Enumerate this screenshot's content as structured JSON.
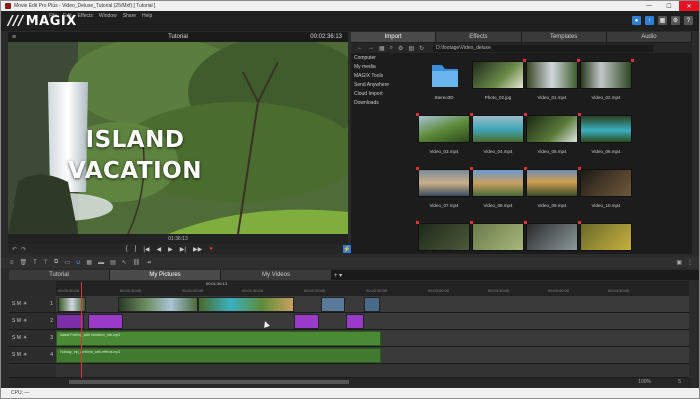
{
  "window": {
    "title": "Movie Edit Pro Plus - Video_Deluxe_Tutorial (25/Mxf) [ Tutorial ]",
    "controls": [
      "—",
      "☐",
      "✕"
    ]
  },
  "menubar": {
    "logo": "MAGIX",
    "items": [
      "File",
      "Edit",
      "Effects",
      "Window",
      "Share",
      "Help"
    ]
  },
  "preview": {
    "title": "Tutorial",
    "timecode": "00:02:36:13",
    "overlay_line1": "ISLAND",
    "overlay_line2": "VACATION",
    "position": "01:36:13",
    "buttons": [
      "[",
      "]",
      "|◀",
      "◀",
      "▶",
      "▶|",
      "▶▶",
      "●"
    ]
  },
  "media": {
    "tabs": [
      "Import",
      "Effects",
      "Templates",
      "Audio"
    ],
    "active_tab": "Import",
    "path": "D:\\footage\\Video_deluxe",
    "nav": [
      "Computer",
      "My media",
      "MAGIX Tools",
      "Send Anywhere",
      "Cloud Import",
      "Downloads"
    ],
    "files": [
      "Stereo3D",
      "Photo_02.jpg",
      "Video_01.mp4",
      "Video_02.mp4",
      "Video_03.mp4",
      "Video_04.mp4",
      "Video_05.mp4",
      "Video_06.mp4",
      "Video_07.mp4",
      "Video_08.mp4",
      "Video_09.mp4",
      "Video_10.mp4",
      "",
      "",
      "",
      ""
    ]
  },
  "timeline": {
    "project_tabs": [
      "Tutorial",
      "My Pictures",
      "My Videos"
    ],
    "active_project_tab": "My Pictures",
    "playhead_time": "00:01:36:13",
    "ruler": [
      "00:00:00:00",
      "00:00:30:00",
      "00:01:00:00",
      "00:01:30:00",
      "00:02:00:00",
      "00:02:30:00",
      "00:03:00:00",
      "00:03:30:00",
      "00:04:00:00",
      "00:04:30:00",
      "00:05:00:00",
      "00:05:30:00"
    ],
    "tracks": [
      {
        "num": "1",
        "label": "S M"
      },
      {
        "num": "2",
        "label": "S M"
      },
      {
        "num": "3",
        "label": "S M"
      },
      {
        "num": "4",
        "label": "S M"
      }
    ],
    "audio_clip_1": "Island Feeling_with narration_mix.mp3",
    "audio_clip_2": "Holiday_trip_ambient_with-effects.mp3",
    "zoom": "100%",
    "zoom_level": "5"
  },
  "status": "CPU: —"
}
